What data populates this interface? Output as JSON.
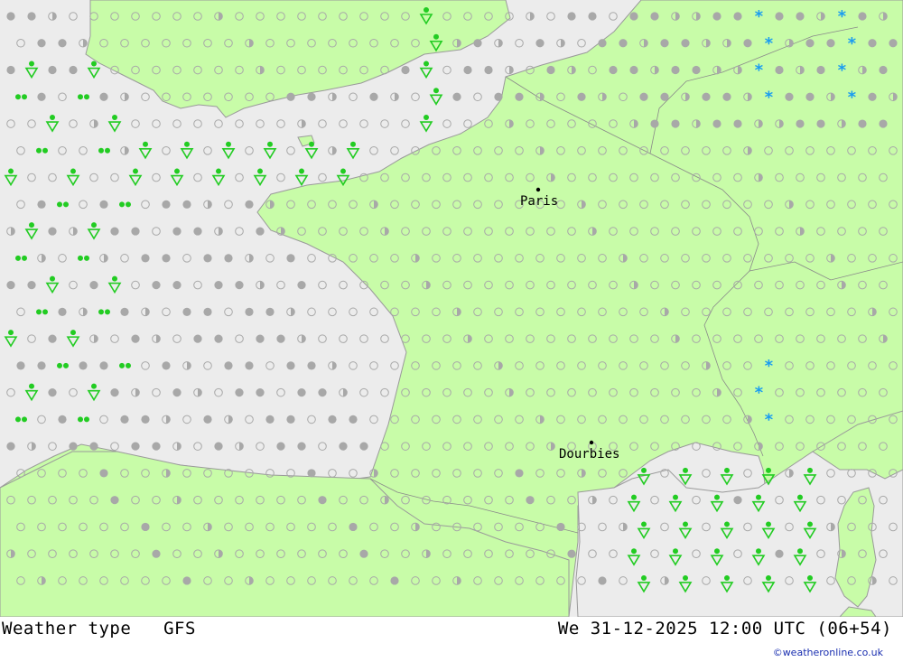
{
  "map": {
    "cities": [
      {
        "name": "Paris"
      },
      {
        "name": "Dourbies"
      }
    ],
    "colors": {
      "sea": "#ececec",
      "land": "#c8fca8",
      "clear_symbol": "#a8a8a8",
      "cloud_symbol": "#a8a8a8",
      "rain_symbol": "#22cc22",
      "snow_symbol": "#1a9cf0",
      "border": "#888888"
    },
    "legend_symbols": [
      "clear-circle",
      "half-cloud-circle",
      "overcast-dot",
      "rain-drops",
      "shower-triangle",
      "snow-asterisk"
    ]
  },
  "footer": {
    "title": "Weather type   GFS",
    "datetime": "We 31-12-2025 12:00 UTC (06+54)",
    "copyright": "©weatheronline.co.uk"
  }
}
